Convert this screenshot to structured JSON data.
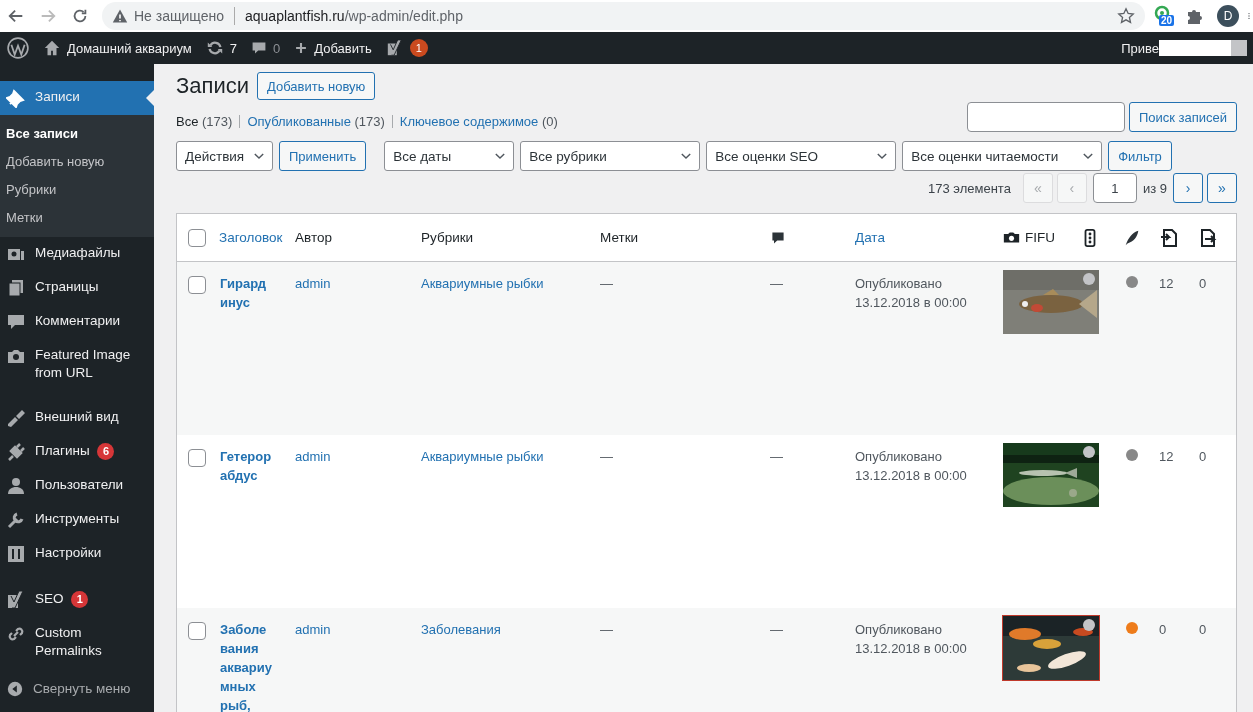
{
  "browser": {
    "security": "Не защищено",
    "host": "aquaplantfish.ru",
    "path": "/wp-admin/edit.php",
    "extension_badge": "20",
    "profile": "D"
  },
  "admin_bar": {
    "site": "Домашний аквариум",
    "updates": "7",
    "comments": "0",
    "new": "Добавить",
    "seo_badge": "1",
    "greeting": "Приве"
  },
  "sidebar": {
    "groups": [
      [
        {
          "label": "Записи",
          "selected": true,
          "submenu": [
            {
              "label": "Все записи",
              "selected": true
            },
            {
              "label": "Добавить новую",
              "selected": false
            },
            {
              "label": "Рубрики",
              "selected": false
            },
            {
              "label": "Метки",
              "selected": false
            }
          ]
        },
        {
          "label": "Медиафайлы",
          "selected": false
        },
        {
          "label": "Страницы",
          "selected": false
        },
        {
          "label": "Комментарии",
          "selected": false
        },
        {
          "label": "Featured Image from URL",
          "selected": false
        }
      ],
      [
        {
          "label": "Внешний вид",
          "selected": false
        },
        {
          "label": "Плагины",
          "selected": false,
          "badge": "6"
        },
        {
          "label": "Пользователи",
          "selected": false
        },
        {
          "label": "Инструменты",
          "selected": false
        },
        {
          "label": "Настройки",
          "selected": false
        }
      ],
      [
        {
          "label": "SEO",
          "selected": false,
          "badge": "1"
        },
        {
          "label": "Custom Permalinks",
          "selected": false
        }
      ]
    ],
    "collapse": "Свернуть меню"
  },
  "page": {
    "title": "Записи",
    "add_new": "Добавить новую",
    "views": [
      {
        "label": "Все",
        "count": "(173)",
        "selected": true
      },
      {
        "label": "Опубликованные",
        "count": "(173)",
        "selected": false
      },
      {
        "label": "Ключевое содержимое",
        "count": "(0)",
        "selected": false
      }
    ],
    "search_button": "Поиск записей",
    "bulk_action": "Действия",
    "apply": "Применить",
    "filters": [
      "Все даты",
      "Все рубрики",
      "Все оценки SEO",
      "Все оценки читаемости"
    ],
    "filter_button": "Фильтр",
    "select_all_checked": false,
    "items_count": "173 элемента",
    "pagination": {
      "first": "«",
      "prev": "‹",
      "current": "1",
      "total": "из 9",
      "next": "›",
      "last": "»",
      "first_disabled": true,
      "prev_disabled": true
    },
    "columns": [
      {
        "kind": "text",
        "label": "Заголовок",
        "link": true
      },
      {
        "kind": "text",
        "label": "Автор",
        "link": false
      },
      {
        "kind": "text",
        "label": "Рубрики",
        "link": false
      },
      {
        "kind": "text",
        "label": "Метки",
        "link": false
      },
      {
        "kind": "comment"
      },
      {
        "kind": "text",
        "label": "Дата",
        "link": true
      },
      {
        "kind": "fifu",
        "label": "FIFU"
      },
      {
        "kind": "seo"
      },
      {
        "kind": "readability"
      },
      {
        "kind": "links_out"
      },
      {
        "kind": "links_in"
      }
    ],
    "rows": [
      {
        "title_lines": [
          "Гирард",
          "инус"
        ],
        "author": "admin",
        "category": "Аквариумные рыбки",
        "tags": "—",
        "comments": "—",
        "date_lines": [
          "Опубликовано",
          "13.12.2018 в 00:00"
        ],
        "image": {
          "kind": "picture"
        },
        "seo": {
          "color": "#c3c4c7"
        },
        "readability": {
          "color": "#888888"
        },
        "links_out": "12",
        "links_in": "0",
        "checked": false
      },
      {
        "title_lines": [
          "Гетерор",
          "абдус"
        ],
        "author": "admin",
        "category": "Аквариумные рыбки",
        "tags": "—",
        "comments": "—",
        "date_lines": [
          "Опубликовано",
          "13.12.2018 в 00:00"
        ],
        "image": {
          "kind": "picture"
        },
        "seo": {
          "color": "#c3c4c7"
        },
        "readability": {
          "color": "#888888"
        },
        "links_out": "12",
        "links_in": "0",
        "checked": false
      },
      {
        "title_lines": [
          "Заболе",
          "вания",
          "аквариу",
          "мных",
          "рыб,"
        ],
        "author": "admin",
        "category": "Заболевания",
        "tags": "—",
        "comments": "—",
        "date_lines": [
          "Опубликовано",
          "13.12.2018 в 00:00"
        ],
        "image": {
          "kind": "picture"
        },
        "seo": {
          "color": "#c3c4c7"
        },
        "readability": {
          "color": "#ee7c1b"
        },
        "links_out": "0",
        "links_in": "0",
        "checked": false
      }
    ]
  }
}
